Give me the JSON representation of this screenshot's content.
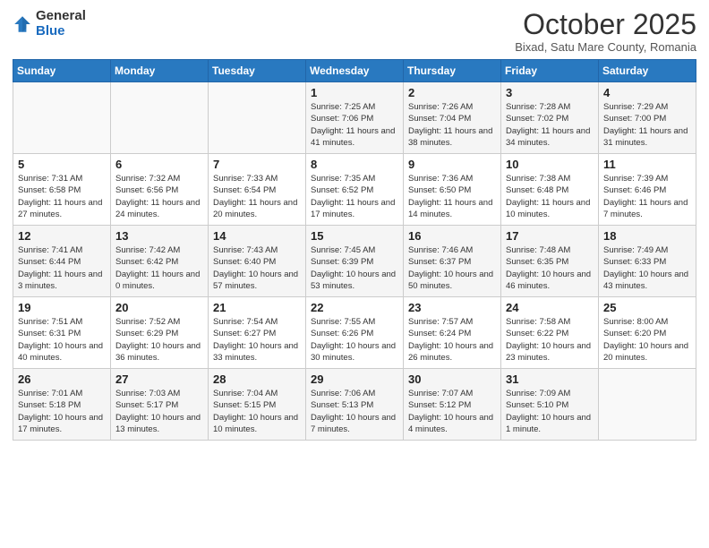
{
  "logo": {
    "general": "General",
    "blue": "Blue"
  },
  "header": {
    "month": "October 2025",
    "location": "Bixad, Satu Mare County, Romania"
  },
  "days_of_week": [
    "Sunday",
    "Monday",
    "Tuesday",
    "Wednesday",
    "Thursday",
    "Friday",
    "Saturday"
  ],
  "weeks": [
    [
      {
        "day": "",
        "info": ""
      },
      {
        "day": "",
        "info": ""
      },
      {
        "day": "",
        "info": ""
      },
      {
        "day": "1",
        "info": "Sunrise: 7:25 AM\nSunset: 7:06 PM\nDaylight: 11 hours and 41 minutes."
      },
      {
        "day": "2",
        "info": "Sunrise: 7:26 AM\nSunset: 7:04 PM\nDaylight: 11 hours and 38 minutes."
      },
      {
        "day": "3",
        "info": "Sunrise: 7:28 AM\nSunset: 7:02 PM\nDaylight: 11 hours and 34 minutes."
      },
      {
        "day": "4",
        "info": "Sunrise: 7:29 AM\nSunset: 7:00 PM\nDaylight: 11 hours and 31 minutes."
      }
    ],
    [
      {
        "day": "5",
        "info": "Sunrise: 7:31 AM\nSunset: 6:58 PM\nDaylight: 11 hours and 27 minutes."
      },
      {
        "day": "6",
        "info": "Sunrise: 7:32 AM\nSunset: 6:56 PM\nDaylight: 11 hours and 24 minutes."
      },
      {
        "day": "7",
        "info": "Sunrise: 7:33 AM\nSunset: 6:54 PM\nDaylight: 11 hours and 20 minutes."
      },
      {
        "day": "8",
        "info": "Sunrise: 7:35 AM\nSunset: 6:52 PM\nDaylight: 11 hours and 17 minutes."
      },
      {
        "day": "9",
        "info": "Sunrise: 7:36 AM\nSunset: 6:50 PM\nDaylight: 11 hours and 14 minutes."
      },
      {
        "day": "10",
        "info": "Sunrise: 7:38 AM\nSunset: 6:48 PM\nDaylight: 11 hours and 10 minutes."
      },
      {
        "day": "11",
        "info": "Sunrise: 7:39 AM\nSunset: 6:46 PM\nDaylight: 11 hours and 7 minutes."
      }
    ],
    [
      {
        "day": "12",
        "info": "Sunrise: 7:41 AM\nSunset: 6:44 PM\nDaylight: 11 hours and 3 minutes."
      },
      {
        "day": "13",
        "info": "Sunrise: 7:42 AM\nSunset: 6:42 PM\nDaylight: 11 hours and 0 minutes."
      },
      {
        "day": "14",
        "info": "Sunrise: 7:43 AM\nSunset: 6:40 PM\nDaylight: 10 hours and 57 minutes."
      },
      {
        "day": "15",
        "info": "Sunrise: 7:45 AM\nSunset: 6:39 PM\nDaylight: 10 hours and 53 minutes."
      },
      {
        "day": "16",
        "info": "Sunrise: 7:46 AM\nSunset: 6:37 PM\nDaylight: 10 hours and 50 minutes."
      },
      {
        "day": "17",
        "info": "Sunrise: 7:48 AM\nSunset: 6:35 PM\nDaylight: 10 hours and 46 minutes."
      },
      {
        "day": "18",
        "info": "Sunrise: 7:49 AM\nSunset: 6:33 PM\nDaylight: 10 hours and 43 minutes."
      }
    ],
    [
      {
        "day": "19",
        "info": "Sunrise: 7:51 AM\nSunset: 6:31 PM\nDaylight: 10 hours and 40 minutes."
      },
      {
        "day": "20",
        "info": "Sunrise: 7:52 AM\nSunset: 6:29 PM\nDaylight: 10 hours and 36 minutes."
      },
      {
        "day": "21",
        "info": "Sunrise: 7:54 AM\nSunset: 6:27 PM\nDaylight: 10 hours and 33 minutes."
      },
      {
        "day": "22",
        "info": "Sunrise: 7:55 AM\nSunset: 6:26 PM\nDaylight: 10 hours and 30 minutes."
      },
      {
        "day": "23",
        "info": "Sunrise: 7:57 AM\nSunset: 6:24 PM\nDaylight: 10 hours and 26 minutes."
      },
      {
        "day": "24",
        "info": "Sunrise: 7:58 AM\nSunset: 6:22 PM\nDaylight: 10 hours and 23 minutes."
      },
      {
        "day": "25",
        "info": "Sunrise: 8:00 AM\nSunset: 6:20 PM\nDaylight: 10 hours and 20 minutes."
      }
    ],
    [
      {
        "day": "26",
        "info": "Sunrise: 7:01 AM\nSunset: 5:18 PM\nDaylight: 10 hours and 17 minutes."
      },
      {
        "day": "27",
        "info": "Sunrise: 7:03 AM\nSunset: 5:17 PM\nDaylight: 10 hours and 13 minutes."
      },
      {
        "day": "28",
        "info": "Sunrise: 7:04 AM\nSunset: 5:15 PM\nDaylight: 10 hours and 10 minutes."
      },
      {
        "day": "29",
        "info": "Sunrise: 7:06 AM\nSunset: 5:13 PM\nDaylight: 10 hours and 7 minutes."
      },
      {
        "day": "30",
        "info": "Sunrise: 7:07 AM\nSunset: 5:12 PM\nDaylight: 10 hours and 4 minutes."
      },
      {
        "day": "31",
        "info": "Sunrise: 7:09 AM\nSunset: 5:10 PM\nDaylight: 10 hours and 1 minute."
      },
      {
        "day": "",
        "info": ""
      }
    ]
  ]
}
